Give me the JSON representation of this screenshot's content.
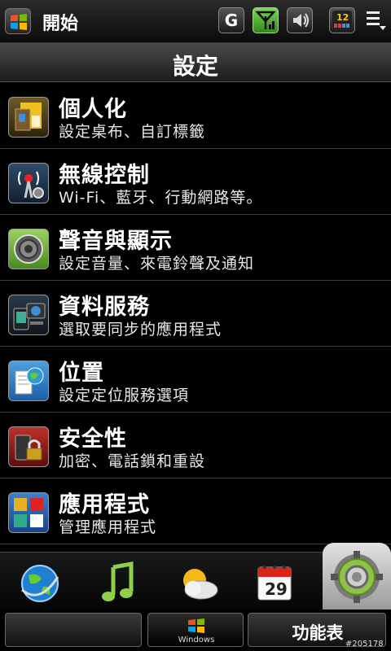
{
  "status_bar": {
    "start_label": "開始",
    "network_letter": "G",
    "battery_level": "12",
    "icons": [
      "windows-flag-icon",
      "signal-icon",
      "volume-icon",
      "battery-icon",
      "menu-icon"
    ]
  },
  "header": {
    "title": "設定"
  },
  "items": [
    {
      "title": "個人化",
      "subtitle": "設定桌布、自訂標籤",
      "icon": "personalize-icon"
    },
    {
      "title": "無線控制",
      "subtitle": "Wi-Fi、藍牙、行動網路等。",
      "icon": "wireless-icon"
    },
    {
      "title": "聲音與顯示",
      "subtitle": "設定音量、來電鈴聲及通知",
      "icon": "speaker-icon"
    },
    {
      "title": "資料服務",
      "subtitle": "選取要同步的應用程式",
      "icon": "data-sync-icon"
    },
    {
      "title": "位置",
      "subtitle": "設定定位服務選項",
      "icon": "location-icon"
    },
    {
      "title": "安全性",
      "subtitle": "加密、電話鎖和重設",
      "icon": "lock-icon"
    },
    {
      "title": "應用程式",
      "subtitle": "管理應用程式",
      "icon": "applications-icon"
    }
  ],
  "dock": {
    "calendar_day": "29",
    "icons": [
      "internet-icon",
      "music-icon",
      "weather-icon",
      "calendar-icon",
      "settings-icon"
    ]
  },
  "bottom_bar": {
    "windows_label": "Windows",
    "menu_label": "功能表"
  },
  "watermark": "#205178",
  "colors": {
    "background": "#000000",
    "accent_green": "#6fc04a"
  }
}
